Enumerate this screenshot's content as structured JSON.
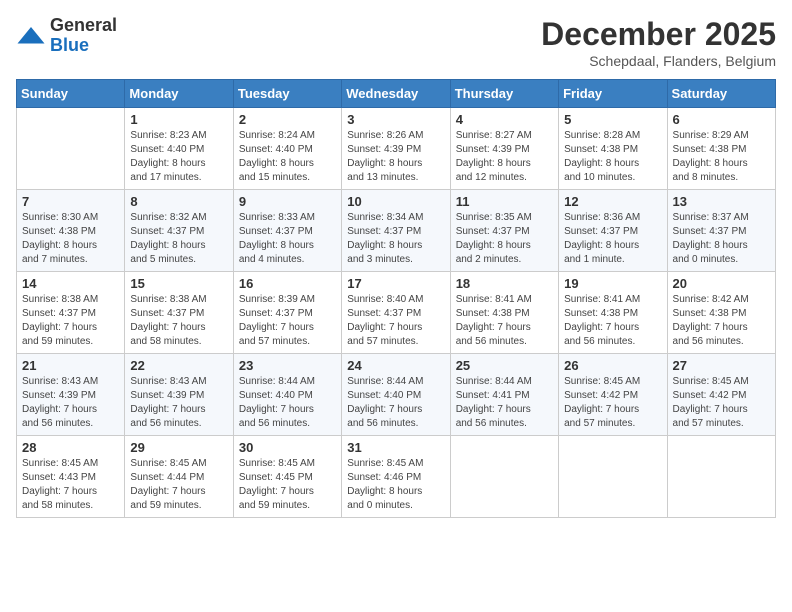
{
  "logo": {
    "general": "General",
    "blue": "Blue"
  },
  "title": "December 2025",
  "location": "Schepdaal, Flanders, Belgium",
  "weekdays": [
    "Sunday",
    "Monday",
    "Tuesday",
    "Wednesday",
    "Thursday",
    "Friday",
    "Saturday"
  ],
  "weeks": [
    [
      {
        "day": "",
        "info": ""
      },
      {
        "day": "1",
        "info": "Sunrise: 8:23 AM\nSunset: 4:40 PM\nDaylight: 8 hours\nand 17 minutes."
      },
      {
        "day": "2",
        "info": "Sunrise: 8:24 AM\nSunset: 4:40 PM\nDaylight: 8 hours\nand 15 minutes."
      },
      {
        "day": "3",
        "info": "Sunrise: 8:26 AM\nSunset: 4:39 PM\nDaylight: 8 hours\nand 13 minutes."
      },
      {
        "day": "4",
        "info": "Sunrise: 8:27 AM\nSunset: 4:39 PM\nDaylight: 8 hours\nand 12 minutes."
      },
      {
        "day": "5",
        "info": "Sunrise: 8:28 AM\nSunset: 4:38 PM\nDaylight: 8 hours\nand 10 minutes."
      },
      {
        "day": "6",
        "info": "Sunrise: 8:29 AM\nSunset: 4:38 PM\nDaylight: 8 hours\nand 8 minutes."
      }
    ],
    [
      {
        "day": "7",
        "info": "Sunrise: 8:30 AM\nSunset: 4:38 PM\nDaylight: 8 hours\nand 7 minutes."
      },
      {
        "day": "8",
        "info": "Sunrise: 8:32 AM\nSunset: 4:37 PM\nDaylight: 8 hours\nand 5 minutes."
      },
      {
        "day": "9",
        "info": "Sunrise: 8:33 AM\nSunset: 4:37 PM\nDaylight: 8 hours\nand 4 minutes."
      },
      {
        "day": "10",
        "info": "Sunrise: 8:34 AM\nSunset: 4:37 PM\nDaylight: 8 hours\nand 3 minutes."
      },
      {
        "day": "11",
        "info": "Sunrise: 8:35 AM\nSunset: 4:37 PM\nDaylight: 8 hours\nand 2 minutes."
      },
      {
        "day": "12",
        "info": "Sunrise: 8:36 AM\nSunset: 4:37 PM\nDaylight: 8 hours\nand 1 minute."
      },
      {
        "day": "13",
        "info": "Sunrise: 8:37 AM\nSunset: 4:37 PM\nDaylight: 8 hours\nand 0 minutes."
      }
    ],
    [
      {
        "day": "14",
        "info": "Sunrise: 8:38 AM\nSunset: 4:37 PM\nDaylight: 7 hours\nand 59 minutes."
      },
      {
        "day": "15",
        "info": "Sunrise: 8:38 AM\nSunset: 4:37 PM\nDaylight: 7 hours\nand 58 minutes."
      },
      {
        "day": "16",
        "info": "Sunrise: 8:39 AM\nSunset: 4:37 PM\nDaylight: 7 hours\nand 57 minutes."
      },
      {
        "day": "17",
        "info": "Sunrise: 8:40 AM\nSunset: 4:37 PM\nDaylight: 7 hours\nand 57 minutes."
      },
      {
        "day": "18",
        "info": "Sunrise: 8:41 AM\nSunset: 4:38 PM\nDaylight: 7 hours\nand 56 minutes."
      },
      {
        "day": "19",
        "info": "Sunrise: 8:41 AM\nSunset: 4:38 PM\nDaylight: 7 hours\nand 56 minutes."
      },
      {
        "day": "20",
        "info": "Sunrise: 8:42 AM\nSunset: 4:38 PM\nDaylight: 7 hours\nand 56 minutes."
      }
    ],
    [
      {
        "day": "21",
        "info": "Sunrise: 8:43 AM\nSunset: 4:39 PM\nDaylight: 7 hours\nand 56 minutes."
      },
      {
        "day": "22",
        "info": "Sunrise: 8:43 AM\nSunset: 4:39 PM\nDaylight: 7 hours\nand 56 minutes."
      },
      {
        "day": "23",
        "info": "Sunrise: 8:44 AM\nSunset: 4:40 PM\nDaylight: 7 hours\nand 56 minutes."
      },
      {
        "day": "24",
        "info": "Sunrise: 8:44 AM\nSunset: 4:40 PM\nDaylight: 7 hours\nand 56 minutes."
      },
      {
        "day": "25",
        "info": "Sunrise: 8:44 AM\nSunset: 4:41 PM\nDaylight: 7 hours\nand 56 minutes."
      },
      {
        "day": "26",
        "info": "Sunrise: 8:45 AM\nSunset: 4:42 PM\nDaylight: 7 hours\nand 57 minutes."
      },
      {
        "day": "27",
        "info": "Sunrise: 8:45 AM\nSunset: 4:42 PM\nDaylight: 7 hours\nand 57 minutes."
      }
    ],
    [
      {
        "day": "28",
        "info": "Sunrise: 8:45 AM\nSunset: 4:43 PM\nDaylight: 7 hours\nand 58 minutes."
      },
      {
        "day": "29",
        "info": "Sunrise: 8:45 AM\nSunset: 4:44 PM\nDaylight: 7 hours\nand 59 minutes."
      },
      {
        "day": "30",
        "info": "Sunrise: 8:45 AM\nSunset: 4:45 PM\nDaylight: 7 hours\nand 59 minutes."
      },
      {
        "day": "31",
        "info": "Sunrise: 8:45 AM\nSunset: 4:46 PM\nDaylight: 8 hours\nand 0 minutes."
      },
      {
        "day": "",
        "info": ""
      },
      {
        "day": "",
        "info": ""
      },
      {
        "day": "",
        "info": ""
      }
    ]
  ]
}
